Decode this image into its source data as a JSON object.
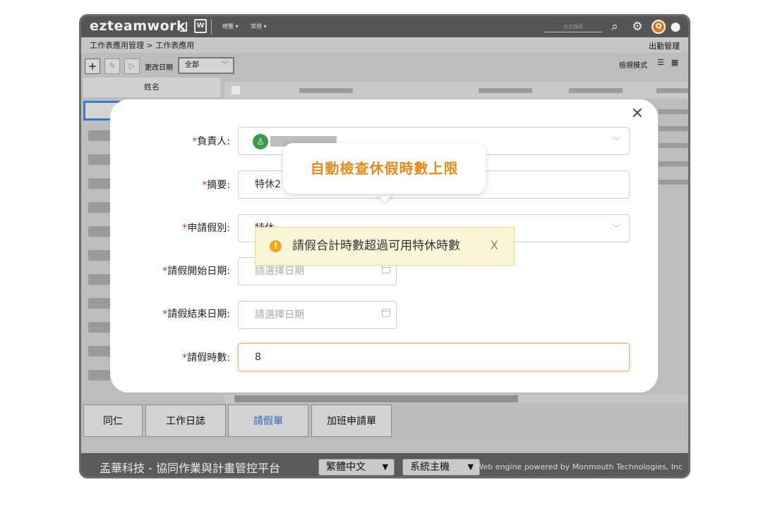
{
  "app": {
    "logo": "ezteamwork",
    "doc_icon": "W",
    "menu": [
      {
        "label": "總覽 ▾"
      },
      {
        "label": "常用 ▾"
      }
    ],
    "search_placeholder": "全文搜尋"
  },
  "breadcrumb": {
    "text": "工作表應用管理 > 工作表應用",
    "right_link": "出勤管理"
  },
  "toolbar": {
    "add": "+",
    "edit": "✎",
    "send": "▷",
    "date_label": "更改日期",
    "filter_value": "全部",
    "view_mode_label": "檢視模式"
  },
  "grid": {
    "name_header": "姓名"
  },
  "tabs": [
    {
      "label": "同仁"
    },
    {
      "label": "工作日誌"
    },
    {
      "label": "請假單"
    },
    {
      "label": "加班申請單"
    }
  ],
  "footer": {
    "title": "孟華科技 - 協同作業與計畫管控平台",
    "language": "繁體中文",
    "host": "系統主機",
    "powered": "Web engine powered by Monmouth Technologies, Inc"
  },
  "modal": {
    "close": "✕",
    "fields": {
      "owner_label": "負責人:",
      "summary_label": "摘要:",
      "summary_value": "特休2",
      "leave_type_label": "申請假別:",
      "leave_type_value": "特休",
      "start_label": "請假開始日期:",
      "start_placeholder": "請選擇日期",
      "end_label": "請假結束日期:",
      "end_placeholder": "請選擇日期",
      "hours_label": "請假時數:",
      "hours_value": "8"
    },
    "required_mark": "*"
  },
  "callout": {
    "text": "自動檢查休假時數上限"
  },
  "warning": {
    "icon": "!",
    "text": "請假合計時數超過可用特休時數",
    "close": "X"
  }
}
